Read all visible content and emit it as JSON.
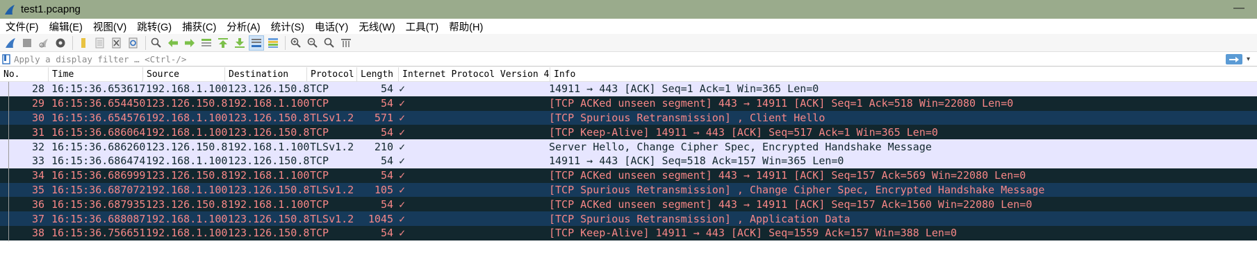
{
  "window": {
    "title": "test1.pcapng",
    "logo_icon": "shark-fin-icon",
    "minimize_glyph": "—"
  },
  "menu": [
    "文件(F)",
    "编辑(E)",
    "视图(V)",
    "跳转(G)",
    "捕获(C)",
    "分析(A)",
    "统计(S)",
    "电话(Y)",
    "无线(W)",
    "工具(T)",
    "帮助(H)"
  ],
  "toolbar_icons": [
    "start-capture-icon",
    "stop-capture-icon",
    "restart-capture-icon",
    "capture-options-icon",
    "open-file-icon",
    "save-file-icon",
    "close-file-icon",
    "reload-icon",
    "find-packet-icon",
    "go-back-icon",
    "go-forward-icon",
    "go-to-packet-icon",
    "first-packet-icon",
    "last-packet-icon",
    "autoscroll-icon",
    "colorize-icon",
    "zoom-in-icon",
    "zoom-out-icon",
    "zoom-normal-icon",
    "resize-columns-icon"
  ],
  "filter": {
    "placeholder": "Apply a display filter … <Ctrl-/>",
    "value": ""
  },
  "columns": [
    "No.",
    "Time",
    "Source",
    "Destination",
    "Protocol",
    "Length",
    "Internet Protocol Version 4",
    "Info"
  ],
  "packets": [
    {
      "no": "28",
      "time": "16:15:36.653617",
      "src": "192.168.1.100",
      "dst": "123.126.150.8",
      "proto": "TCP",
      "len": "54",
      "ipv4": "✓",
      "info": "14911 → 443 [ACK] Seq=1 Ack=1 Win=365 Len=0",
      "style": "light"
    },
    {
      "no": "29",
      "time": "16:15:36.654450",
      "src": "123.126.150.8",
      "dst": "192.168.1.100",
      "proto": "TCP",
      "len": "54",
      "ipv4": "✓",
      "info": "[TCP ACKed unseen segment] 443 → 14911 [ACK] Seq=1 Ack=518 Win=22080 Len=0",
      "style": "dark"
    },
    {
      "no": "30",
      "time": "16:15:36.654576",
      "src": "192.168.1.100",
      "dst": "123.126.150.8",
      "proto": "TLSv1.2",
      "len": "571",
      "ipv4": "✓",
      "info": "[TCP Spurious Retransmission] , Client Hello",
      "style": "dark alt"
    },
    {
      "no": "31",
      "time": "16:15:36.686064",
      "src": "192.168.1.100",
      "dst": "123.126.150.8",
      "proto": "TCP",
      "len": "54",
      "ipv4": "✓",
      "info": "[TCP Keep-Alive] 14911 → 443 [ACK] Seq=517 Ack=1 Win=365 Len=0",
      "style": "dark"
    },
    {
      "no": "32",
      "time": "16:15:36.686260",
      "src": "123.126.150.8",
      "dst": "192.168.1.100",
      "proto": "TLSv1.2",
      "len": "210",
      "ipv4": "✓",
      "info": "Server Hello, Change Cipher Spec, Encrypted Handshake Message",
      "style": "light"
    },
    {
      "no": "33",
      "time": "16:15:36.686474",
      "src": "192.168.1.100",
      "dst": "123.126.150.8",
      "proto": "TCP",
      "len": "54",
      "ipv4": "✓",
      "info": "14911 → 443 [ACK] Seq=518 Ack=157 Win=365 Len=0",
      "style": "light"
    },
    {
      "no": "34",
      "time": "16:15:36.686999",
      "src": "123.126.150.8",
      "dst": "192.168.1.100",
      "proto": "TCP",
      "len": "54",
      "ipv4": "✓",
      "info": "[TCP ACKed unseen segment] 443 → 14911 [ACK] Seq=157 Ack=569 Win=22080 Len=0",
      "style": "dark"
    },
    {
      "no": "35",
      "time": "16:15:36.687072",
      "src": "192.168.1.100",
      "dst": "123.126.150.8",
      "proto": "TLSv1.2",
      "len": "105",
      "ipv4": "✓",
      "info": "[TCP Spurious Retransmission] , Change Cipher Spec, Encrypted Handshake Message",
      "style": "dark alt"
    },
    {
      "no": "36",
      "time": "16:15:36.687935",
      "src": "123.126.150.8",
      "dst": "192.168.1.100",
      "proto": "TCP",
      "len": "54",
      "ipv4": "✓",
      "info": "[TCP ACKed unseen segment] 443 → 14911 [ACK] Seq=157 Ack=1560 Win=22080 Len=0",
      "style": "dark"
    },
    {
      "no": "37",
      "time": "16:15:36.688087",
      "src": "192.168.1.100",
      "dst": "123.126.150.8",
      "proto": "TLSv1.2",
      "len": "1045",
      "ipv4": "✓",
      "info": "[TCP Spurious Retransmission] , Application Data",
      "style": "dark alt"
    },
    {
      "no": "38",
      "time": "16:15:36.756651",
      "src": "192.168.1.100",
      "dst": "123.126.150.8",
      "proto": "TCP",
      "len": "54",
      "ipv4": "✓",
      "info": "[TCP Keep-Alive] 14911 → 443 [ACK] Seq=1559 Ack=157 Win=388 Len=0",
      "style": "dark"
    }
  ],
  "colors": {
    "titlebar": "#9aab8c",
    "row_light_bg": "#e7e6ff",
    "row_light_fg": "#12272e",
    "row_dark_bg": "#12272e",
    "row_dark_alt_bg": "#163a5a",
    "row_dark_fg": "#f78787"
  }
}
